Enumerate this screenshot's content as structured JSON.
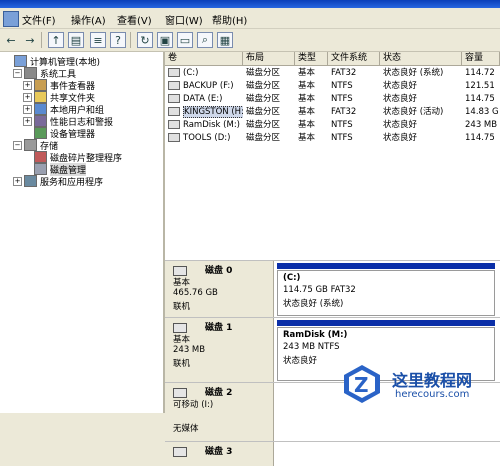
{
  "menu": [
    "文件(F)",
    "操作(A)",
    "查看(V)",
    "窗口(W)",
    "帮助(H)"
  ],
  "tree": [
    {
      "label": "计算机管理(本地)",
      "indent": 0,
      "pm": "",
      "icon": "computer-icon",
      "color": "#7aa0d8"
    },
    {
      "label": "系统工具",
      "indent": 1,
      "pm": "−",
      "icon": "tools-icon",
      "color": "#8a8a8a"
    },
    {
      "label": "事件查看器",
      "indent": 2,
      "pm": "+",
      "icon": "event-viewer-icon",
      "color": "#c89e52"
    },
    {
      "label": "共享文件夹",
      "indent": 2,
      "pm": "+",
      "icon": "shared-folder-icon",
      "color": "#e8c95a"
    },
    {
      "label": "本地用户和组",
      "indent": 2,
      "pm": "+",
      "icon": "users-icon",
      "color": "#5a8ad0"
    },
    {
      "label": "性能日志和警报",
      "indent": 2,
      "pm": "+",
      "icon": "performance-icon",
      "color": "#7a6a9a"
    },
    {
      "label": "设备管理器",
      "indent": 2,
      "pm": "",
      "icon": "device-manager-icon",
      "color": "#5a9a5a"
    },
    {
      "label": "存储",
      "indent": 1,
      "pm": "−",
      "icon": "storage-icon",
      "color": "#9a9a9a"
    },
    {
      "label": "磁盘碎片整理程序",
      "indent": 2,
      "pm": "",
      "icon": "defrag-icon",
      "color": "#c05a5a"
    },
    {
      "label": "磁盘管理",
      "indent": 2,
      "pm": "",
      "icon": "disk-management-icon",
      "color": "#9aa0b0",
      "selected": true
    },
    {
      "label": "服务和应用程序",
      "indent": 1,
      "pm": "+",
      "icon": "services-icon",
      "color": "#6a8aa0"
    }
  ],
  "columns": [
    "卷",
    "布局",
    "类型",
    "文件系统",
    "状态",
    "容量"
  ],
  "volumes": [
    {
      "vol": "(C:)",
      "layout": "磁盘分区",
      "type": "基本",
      "fs": "FAT32",
      "status": "状态良好 (系统)",
      "cap": "114.72"
    },
    {
      "vol": "BACKUP (F:)",
      "layout": "磁盘分区",
      "type": "基本",
      "fs": "NTFS",
      "status": "状态良好",
      "cap": "121.51"
    },
    {
      "vol": "DATA (E:)",
      "layout": "磁盘分区",
      "type": "基本",
      "fs": "NTFS",
      "status": "状态良好",
      "cap": "114.75"
    },
    {
      "vol": "KINGSTON (H:)",
      "layout": "磁盘分区",
      "type": "基本",
      "fs": "FAT32",
      "status": "状态良好 (活动)",
      "cap": "14.83 G",
      "selected": true
    },
    {
      "vol": "RamDisk (M:)",
      "layout": "磁盘分区",
      "type": "基本",
      "fs": "NTFS",
      "status": "状态良好",
      "cap": "243 MB"
    },
    {
      "vol": "TOOLS (D:)",
      "layout": "磁盘分区",
      "type": "基本",
      "fs": "NTFS",
      "status": "状态良好",
      "cap": "114.75"
    }
  ],
  "disks": [
    {
      "name": "磁盘 0",
      "lines": [
        "基本",
        "465.76 GB",
        "联机"
      ],
      "part": {
        "title": "(C:)",
        "l2": "114.75 GB FAT32",
        "l3": "状态良好 (系统)"
      }
    },
    {
      "name": "磁盘 1",
      "lines": [
        "基本",
        "243 MB",
        "联机"
      ],
      "part": {
        "title": "RamDisk  (M:)",
        "l2": "243 MB NTFS",
        "l3": "状态良好"
      }
    },
    {
      "name": "磁盘 2",
      "lines": [
        "可移动 (I:)",
        "",
        "无媒体"
      ],
      "part": null
    },
    {
      "name": "磁盘 3",
      "lines": [],
      "part": null
    }
  ],
  "watermark": {
    "title": "这里教程网",
    "url": "herecours.com"
  },
  "colors": {
    "partition_bar": "#0b2fa8",
    "watermark": "#1a4fa8"
  }
}
